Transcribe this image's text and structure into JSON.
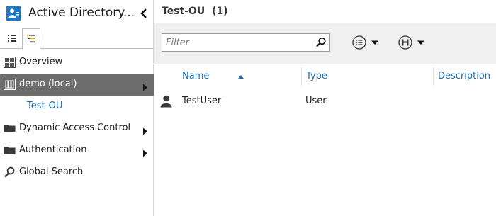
{
  "app": {
    "title": "Active Directory..."
  },
  "nav": {
    "items": [
      {
        "label": "Overview",
        "icon": "grid-icon"
      },
      {
        "label": "demo (local)",
        "icon": "domain-icon",
        "selected": true
      },
      {
        "label": "Test-OU",
        "child": true
      },
      {
        "label": "Dynamic Access Control",
        "icon": "folder-icon"
      },
      {
        "label": "Authentication",
        "icon": "folder-icon"
      },
      {
        "label": "Global Search",
        "icon": "search-icon"
      }
    ]
  },
  "main": {
    "title": "Test-OU",
    "count": "(1)",
    "filter": {
      "placeholder": "Filter",
      "value": ""
    },
    "columns": {
      "name": "Name",
      "type": "Type",
      "description": "Description"
    },
    "rows": [
      {
        "name": "TestUser",
        "type": "User",
        "description": ""
      }
    ]
  },
  "colors": {
    "accent": "#1e78c8",
    "link": "#1e6fb5",
    "selected_bg": "#6d6d6d",
    "toolbar_bg": "#f0f0f0"
  }
}
